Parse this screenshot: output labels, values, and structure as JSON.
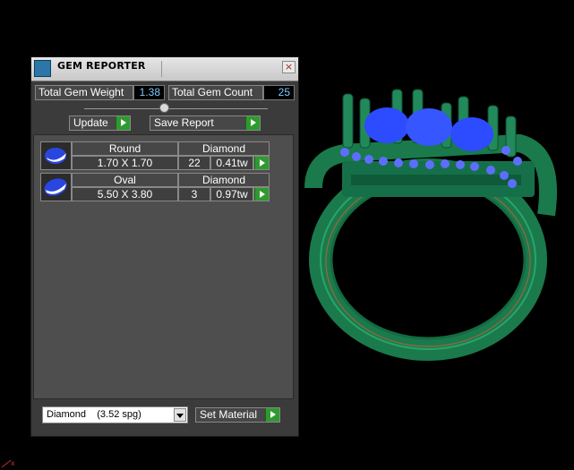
{
  "viewport": {
    "background": "#000000",
    "ring_color": "#1f8a5a",
    "stone_color": "#2a4bff"
  },
  "panel": {
    "title": "GEM REPORTER",
    "close": "×",
    "total_gem_weight_label": "Total Gem Weight",
    "total_gem_weight_value": "1.38",
    "total_gem_count_label": "Total Gem Count",
    "total_gem_count_value": "25",
    "update_label": "Update",
    "save_report_label": "Save Report",
    "gems": [
      {
        "shape": "Round",
        "material": "Diamond",
        "size": "1.70 X 1.70",
        "count": "22",
        "weight": "0.41tw"
      },
      {
        "shape": "Oval",
        "material": "Diamond",
        "size": "5.50 X 3.80",
        "count": "3",
        "weight": "0.97tw"
      }
    ],
    "material_select": "Diamond    (3.52 spg)",
    "set_material_label": "Set Material",
    "accent_color": "#2f9a2f"
  }
}
